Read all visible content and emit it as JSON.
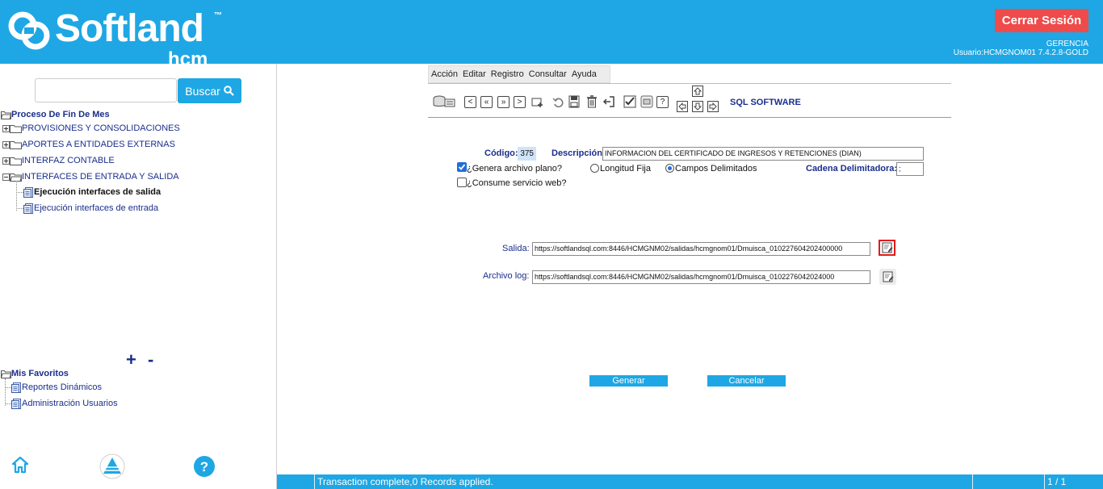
{
  "header": {
    "brand": "Softland",
    "brand_tm": "™",
    "brand_sub": "hcm",
    "logout_label": "Cerrar Sesión",
    "company": "GERENCIA",
    "user": "Usuario:HCMGNOM01 7.4.2.8-GOLD"
  },
  "sidebar": {
    "search": {
      "value": "",
      "placeholder": "",
      "button": "Buscar",
      "button_icon": "search-icon"
    },
    "tree": {
      "root": "Proceso De Fin De Mes",
      "items": [
        {
          "label": "PROVISIONES Y CONSOLIDACIONES",
          "expanded": false
        },
        {
          "label": "APORTES A ENTIDADES EXTERNAS",
          "expanded": false
        },
        {
          "label": "INTERFAZ CONTABLE",
          "expanded": false
        },
        {
          "label": "INTERFACES DE ENTRADA Y SALIDA",
          "expanded": true
        }
      ],
      "children": [
        {
          "label": "Ejecución interfaces de salida",
          "selected": true
        },
        {
          "label": "Ejecución interfaces de entrada",
          "selected": false
        }
      ]
    },
    "expand_collapse": "+ -",
    "favorites": {
      "root": "Mis Favoritos",
      "items": [
        "Reportes Dinámicos",
        "Administración Usuarios"
      ]
    },
    "bottom_icons": [
      "home-icon",
      "triangle-logo-icon",
      "help-icon"
    ]
  },
  "menu": [
    "Acción",
    "Editar",
    "Registro",
    "Consultar",
    "Ayuda"
  ],
  "toolbar": {
    "icons": [
      "db-icon",
      "first-icon",
      "prev-icon",
      "next-page-icon",
      "last-icon",
      "add-record-icon",
      "undo-icon",
      "save-icon",
      "delete-icon",
      "exit-icon",
      "check-icon",
      "print-icon",
      "help-icon",
      "nav-up-icon",
      "nav-left-icon",
      "nav-down-icon",
      "nav-right-icon"
    ],
    "help_glyph": "?",
    "sql_label": "SQL SOFTWARE"
  },
  "form": {
    "codigo_label": "Código:",
    "codigo_value": "375",
    "descripcion_label": "Descripción:",
    "descripcion_value": "INFORMACION DEL CERTIFICADO DE INGRESOS Y RETENCIONES (DIAN)",
    "genera_label": "¿Genera archivo plano?",
    "genera_checked": true,
    "longitud_label": "Longitud Fija",
    "campos_label": "Campos Delimitados",
    "delimiter_mode": "Campos Delimitados",
    "cadena_label": "Cadena Delimitadora:",
    "cadena_value": ";",
    "consume_label": "¿Consume servicio web?",
    "consume_checked": false,
    "salida_label": "Salida:",
    "salida_value": "https://softlandsql.com:8446/HCMGNM02/salidas/hcmgnom01/Dmuisca_010227604202400000",
    "log_label": "Archivo log:",
    "log_value": "https://softlandsql.com:8446/HCMGNM02/salidas/hcmgnom01/Dmuisca_0102276042024000",
    "generar_label": "Generar",
    "cancelar_label": "Cancelar"
  },
  "status": {
    "message": "Transaction complete,0 Records applied.",
    "page": "1 / 1"
  }
}
